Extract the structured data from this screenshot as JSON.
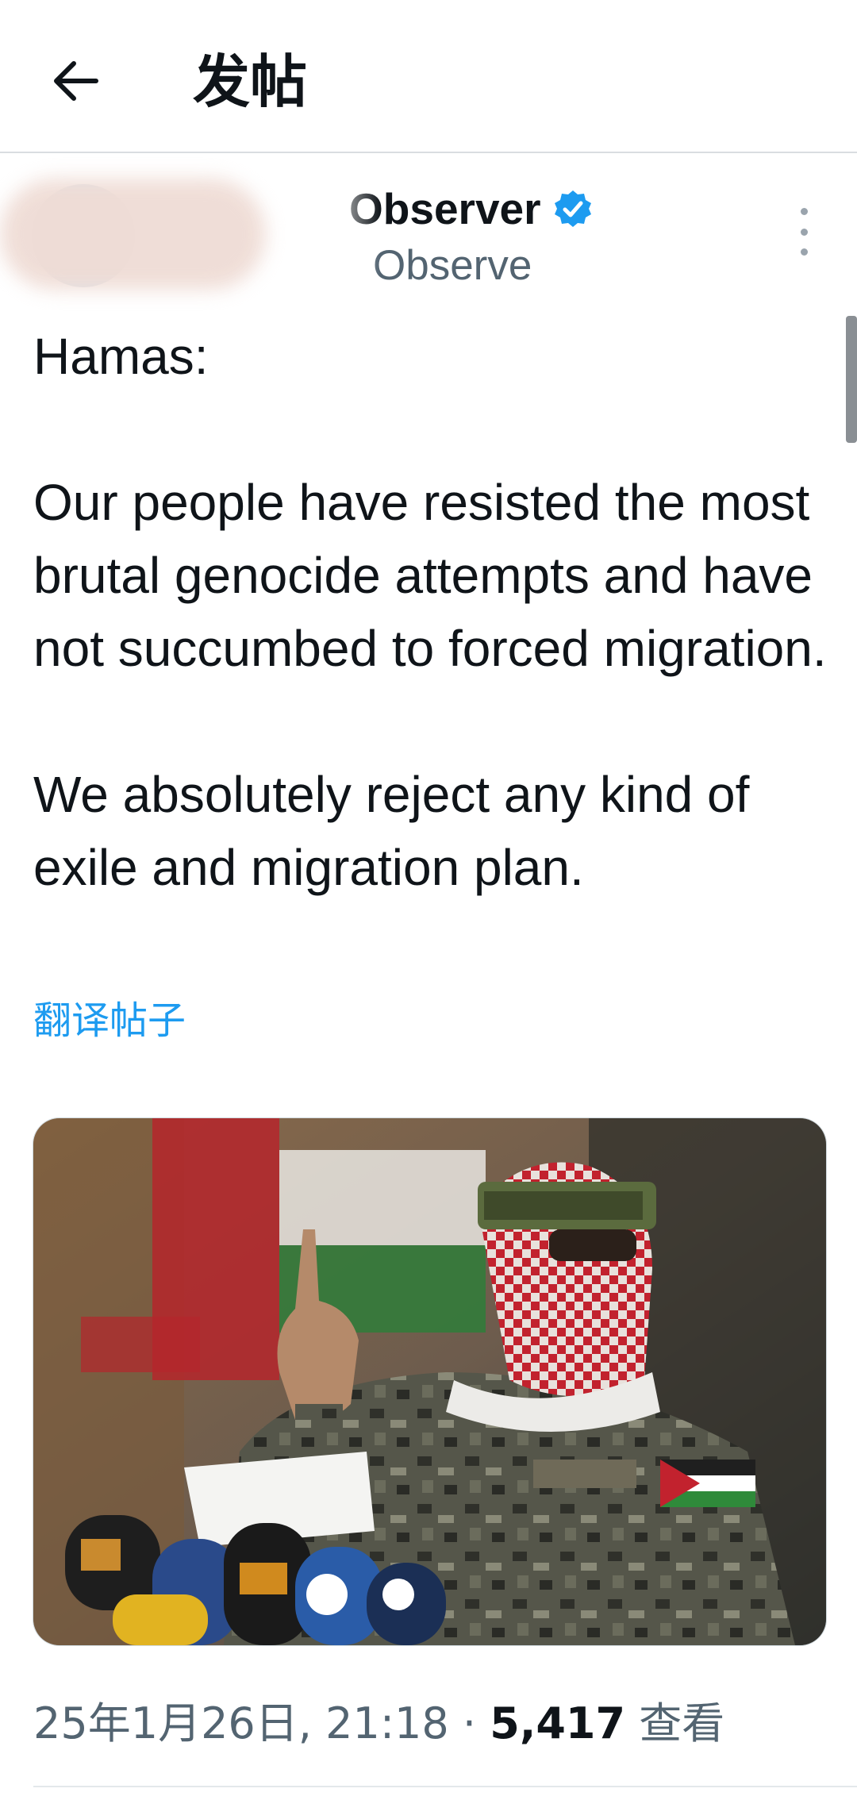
{
  "header": {
    "back_label": "←",
    "title": "发帖"
  },
  "author": {
    "display_name": "Observer",
    "handle": "Observe",
    "verified_color": "#1d9bf0"
  },
  "post": {
    "paragraphs": [
      "Hamas:",
      "Our people have resisted the most brutal genocide attempts and have not succumbed to forced migration.",
      "We absolutely reject any kind of exile and migration plan."
    ],
    "translate_label": "翻译帖子"
  },
  "meta": {
    "timestamp": "25年1月26日, 21:18",
    "separator": "·",
    "views_count": "5,417",
    "views_label": "查看"
  },
  "colors": {
    "accent": "#1d9bf0",
    "secondary_text": "#536471"
  }
}
